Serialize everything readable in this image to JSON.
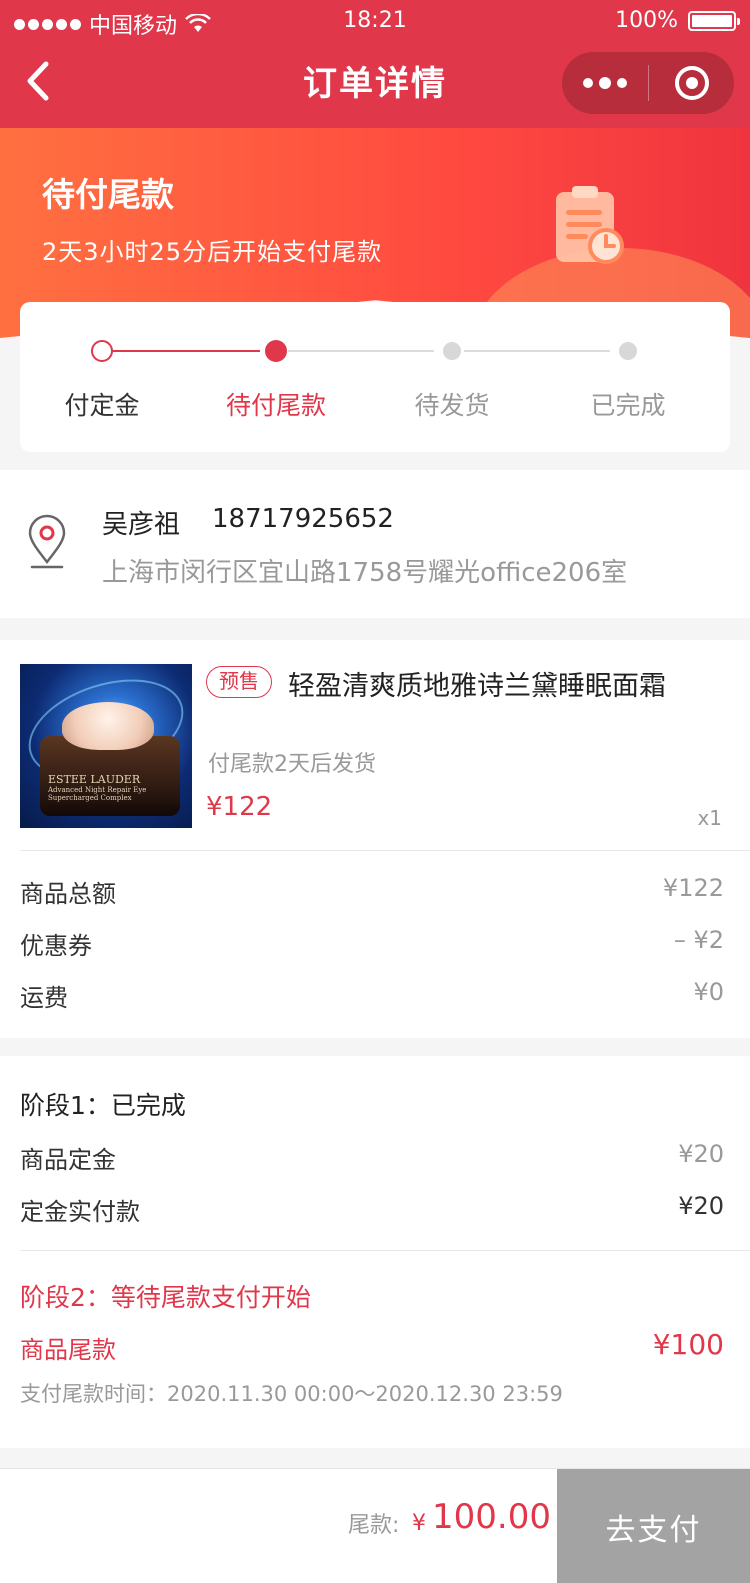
{
  "status_bar": {
    "carrier": "中国移动",
    "time": "18:21",
    "battery": "100%"
  },
  "nav": {
    "title": "订单详情"
  },
  "hero": {
    "title": "待付尾款",
    "subtitle": "2天3小时25分后开始支付尾款"
  },
  "steps": {
    "items": [
      {
        "label": "付定金",
        "state": "done"
      },
      {
        "label": "待付尾款",
        "state": "current"
      },
      {
        "label": "待发货",
        "state": "pending"
      },
      {
        "label": "已完成",
        "state": "pending"
      }
    ]
  },
  "address": {
    "name": "吴彦祖",
    "phone": "18717925652",
    "detail": "上海市闵行区宜山路1758号耀光office206室"
  },
  "product": {
    "tag": "预售",
    "name": "轻盈清爽质地雅诗兰黛睡眠面霜",
    "note": "付尾款2天后发货",
    "price": "¥122",
    "qty": "x1",
    "image_brand": "ESTEE LAUDER",
    "image_caption": "Advanced Night Repair Eye Supercharged Complex"
  },
  "fees": [
    {
      "label": "商品总额",
      "value": "¥122"
    },
    {
      "label": "优惠券",
      "value": "– ¥2"
    },
    {
      "label": "运费",
      "value": "¥0"
    }
  ],
  "stage1": {
    "title": "阶段1：已完成",
    "deposit_label": "商品定金",
    "deposit_value": "¥20",
    "paid_label": "定金实付款",
    "paid_value": "¥20"
  },
  "stage2": {
    "title": "阶段2：等待尾款支付开始",
    "final_label": "商品尾款",
    "final_value": "¥100",
    "window": "支付尾款时间：2020.11.30 00:00～2020.12.30 23:59"
  },
  "bottom": {
    "final_label": "尾款:",
    "currency": "¥",
    "amount": "100.00",
    "pay_button": "去支付"
  },
  "colors": {
    "brand_red": "#e0374a",
    "hero_orange": "#ff7040",
    "disabled_button": "#a3a3a3"
  }
}
